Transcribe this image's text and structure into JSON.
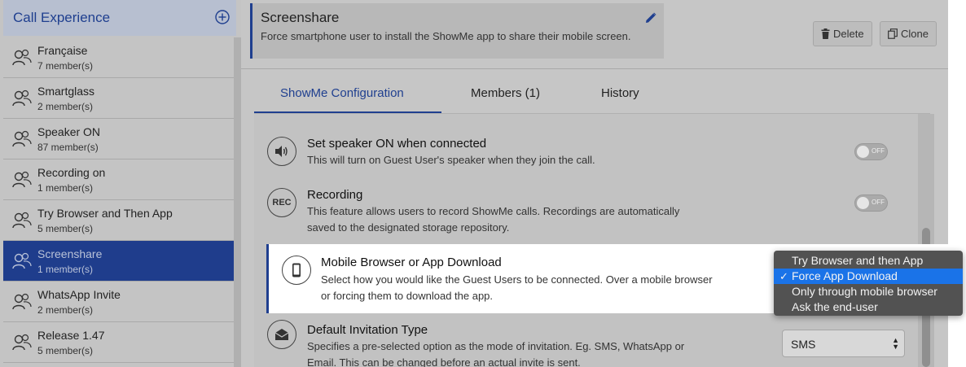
{
  "sidebar": {
    "title": "Call Experience",
    "items": [
      {
        "name": "Française",
        "count": "7 member(s)"
      },
      {
        "name": "Smartglass",
        "count": "2 member(s)"
      },
      {
        "name": "Speaker ON",
        "count": "87 member(s)"
      },
      {
        "name": "Recording on",
        "count": "1 member(s)"
      },
      {
        "name": "Try Browser and Then App",
        "count": "5 member(s)"
      },
      {
        "name": "Screenshare",
        "count": "1 member(s)",
        "selected": true
      },
      {
        "name": "WhatsApp Invite",
        "count": "2 member(s)"
      },
      {
        "name": "Release 1.47",
        "count": "5 member(s)"
      }
    ]
  },
  "header": {
    "title": "Screenshare",
    "description": "Force smartphone user to install the ShowMe app to share their mobile screen.",
    "delete_label": "Delete",
    "clone_label": "Clone"
  },
  "tabs": [
    {
      "label": "ShowMe Configuration",
      "active": true
    },
    {
      "label": "Members (1)"
    },
    {
      "label": "History"
    }
  ],
  "settings": {
    "speaker": {
      "icon": "speaker-icon",
      "title": "Set speaker ON when connected",
      "description": "This will turn on Guest User's speaker when they join the call.",
      "toggle": "OFF"
    },
    "recording": {
      "icon": "rec-icon",
      "icon_text": "REC",
      "title": "Recording",
      "description_line1": "This feature allows users to record ShowMe calls. Recordings are automatically",
      "description_line2": "saved to the designated storage repository.",
      "toggle": "OFF"
    },
    "mobile": {
      "icon": "smartphone-icon",
      "title": "Mobile Browser or App Download",
      "description_line1": "Select how you would like the Guest Users to be connected. Over a mobile browser",
      "description_line2": "or forcing them to download the app."
    },
    "invitation": {
      "icon": "envelope-icon",
      "title": "Default Invitation Type",
      "description_line1": "Specifies a pre-selected option as the mode of invitation. Eg. SMS, WhatsApp or",
      "description_line2": "Email. This can be changed before an actual invite is sent.",
      "selected": "SMS"
    }
  },
  "dropdown": {
    "options": [
      "Try Browser and then App",
      "Force App Download",
      "Only through mobile browser",
      "Ask the end-user"
    ],
    "selected_index": 1,
    "check": "✓"
  },
  "colors": {
    "accent": "#1f3f8f",
    "selection": "#1a73e8"
  }
}
